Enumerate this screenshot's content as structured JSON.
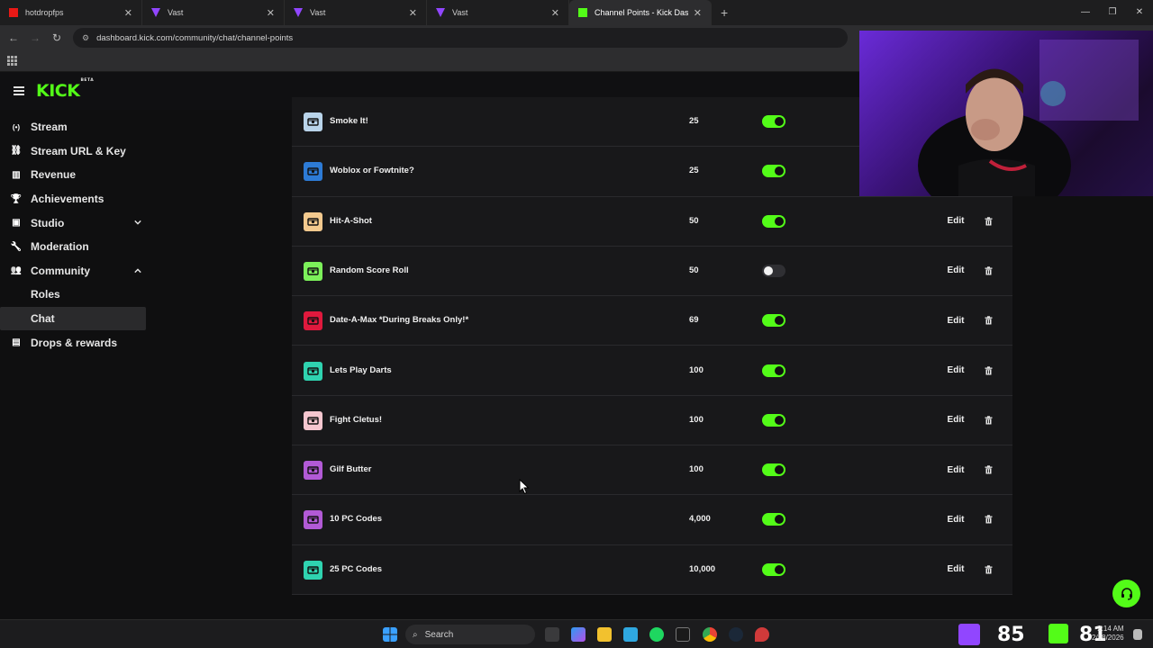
{
  "browser": {
    "tabs": [
      {
        "title": "hotdropfps",
        "icon": "kick-icon",
        "color": "#e91916"
      },
      {
        "title": "Vast",
        "icon": "vast-icon",
        "color": "#9146ff"
      },
      {
        "title": "Vast",
        "icon": "vast-icon",
        "color": "#9146ff"
      },
      {
        "title": "Vast",
        "icon": "vast-icon",
        "color": "#9146ff"
      },
      {
        "title": "Channel Points - Kick Dashboard",
        "icon": "kick-icon",
        "color": "#53fc18"
      }
    ],
    "url": "dashboard.kick.com/community/chat/channel-points"
  },
  "logo": {
    "text": "KICK",
    "badge": "BETA"
  },
  "sidebar": {
    "items": [
      {
        "label": "Stream",
        "icon": "broadcast-icon"
      },
      {
        "label": "Stream URL & Key",
        "icon": "link-icon"
      },
      {
        "label": "Revenue",
        "icon": "chart-icon"
      },
      {
        "label": "Achievements",
        "icon": "trophy-icon"
      },
      {
        "label": "Studio",
        "icon": "studio-icon",
        "chevron": "down"
      },
      {
        "label": "Moderation",
        "icon": "wrench-icon"
      },
      {
        "label": "Community",
        "icon": "people-icon",
        "chevron": "up"
      },
      {
        "label": "Roles",
        "sub": true
      },
      {
        "label": "Chat",
        "sub": true,
        "selected": true
      },
      {
        "label": "Drops & rewards",
        "icon": "gift-icon"
      }
    ]
  },
  "rewards": [
    {
      "name": "Smoke It!",
      "cost": "25",
      "enabled": true,
      "color": "#b9d4ea",
      "actions": false
    },
    {
      "name": "Woblox or Fowtnite?",
      "cost": "25",
      "enabled": true,
      "color": "#2d7bd6",
      "actions": false
    },
    {
      "name": "Hit-A-Shot",
      "cost": "50",
      "enabled": true,
      "color": "#f3c98e",
      "actions": true
    },
    {
      "name": "Random Score Roll",
      "cost": "50",
      "enabled": false,
      "color": "#7cf05a",
      "actions": true
    },
    {
      "name": "Date-A-Max *During Breaks Only!*",
      "cost": "69",
      "enabled": true,
      "color": "#e0193d",
      "actions": true
    },
    {
      "name": "Lets Play Darts",
      "cost": "100",
      "enabled": true,
      "color": "#2fd3b0",
      "actions": true
    },
    {
      "name": "Fight Cletus!",
      "cost": "100",
      "enabled": true,
      "color": "#f5c6cf",
      "actions": true
    },
    {
      "name": "Gilf Butter",
      "cost": "100",
      "enabled": true,
      "color": "#b25ad6",
      "actions": true
    },
    {
      "name": "10 PC Codes",
      "cost": "4,000",
      "enabled": true,
      "color": "#b25ad6",
      "actions": true
    },
    {
      "name": "25 PC Codes",
      "cost": "10,000",
      "enabled": true,
      "color": "#2fd3b0",
      "actions": true
    }
  ],
  "edit_label": "Edit",
  "accent": "#53fc18",
  "taskbar": {
    "search_placeholder": "Search",
    "counter_left": "85",
    "counter_right": "81",
    "time": "2:14 AM",
    "date": "2/18/2026"
  }
}
